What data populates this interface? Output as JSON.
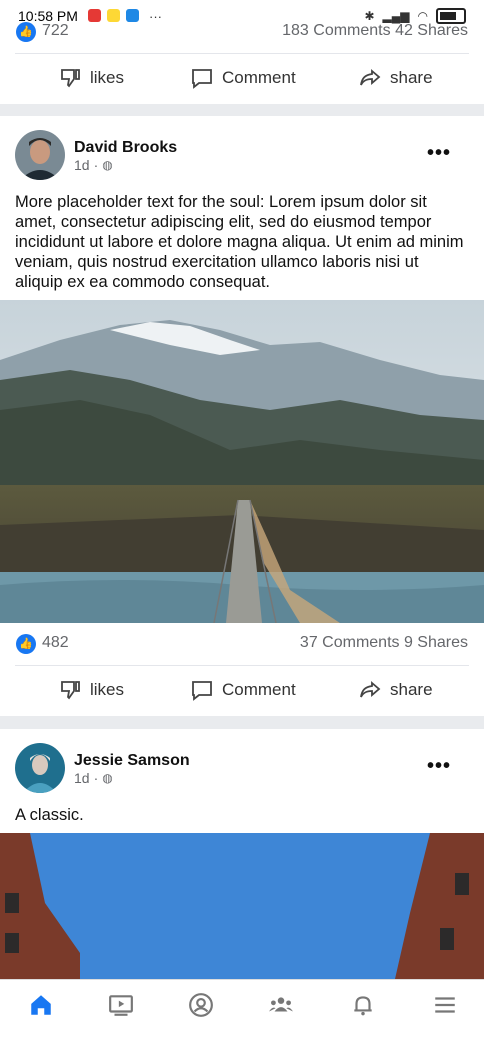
{
  "status": {
    "time": "10:58 PM",
    "more": "···"
  },
  "post_top": {
    "likes": "722",
    "comments_shares": "183 Comments  42 Shares"
  },
  "post1": {
    "author": "David Brooks",
    "time": "1d",
    "text": "More placeholder text for the soul: Lorem ipsum dolor sit amet, consectetur adipiscing elit, sed do eiusmod tempor incididunt ut labore et dolore magna aliqua. Ut enim ad minim veniam, quis nostrud exercitation ullamco laboris nisi ut aliquip ex ea commodo consequat.",
    "likes": "482",
    "comments_shares": "37 Comments  9 Shares"
  },
  "post2": {
    "author": "Jessie Samson",
    "time": "1d",
    "text": "A classic."
  },
  "actions": {
    "like": "likes",
    "comment": "Comment",
    "share": "share"
  },
  "icons": [
    "home-icon",
    "video-icon",
    "profile-icon",
    "groups-icon",
    "bell-icon",
    "menu-icon"
  ],
  "colors": {
    "accent": "#1877f2",
    "background": "#e9ebee"
  }
}
